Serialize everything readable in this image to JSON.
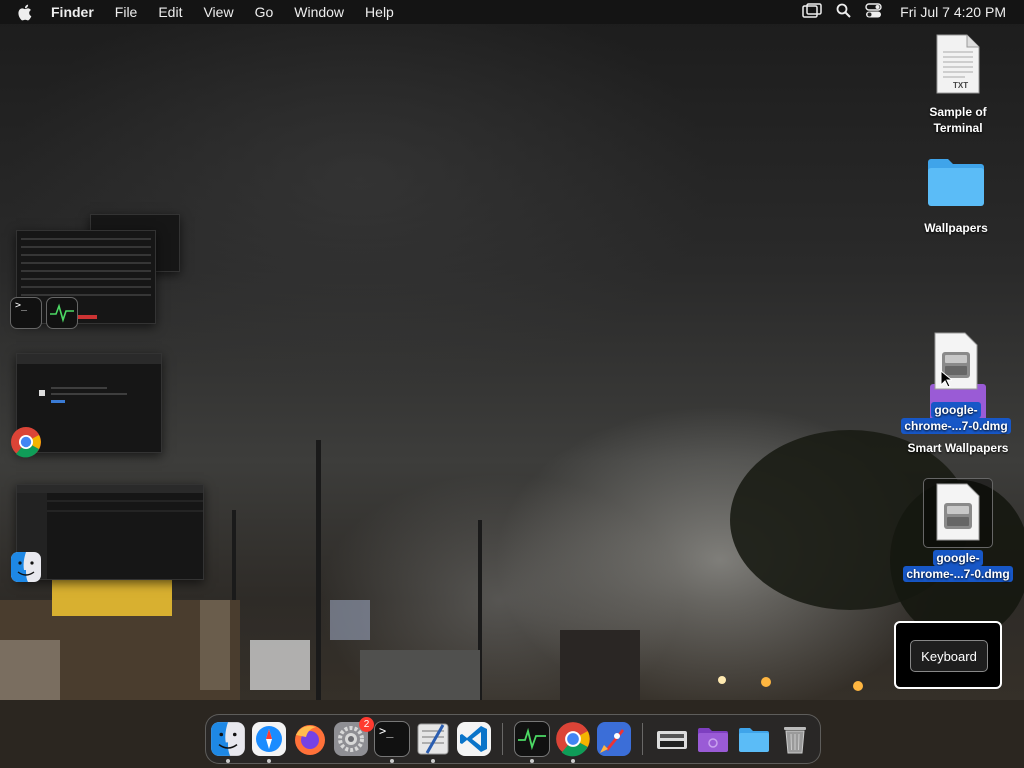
{
  "menubar": {
    "app_name": "Finder",
    "menus": [
      "File",
      "Edit",
      "View",
      "Go",
      "Window",
      "Help"
    ],
    "clock": "Fri Jul 7  4:20 PM",
    "status_icons": [
      "screen-mirroring-icon",
      "spotlight-search-icon",
      "control-center-icon"
    ]
  },
  "desktop": {
    "icons": [
      {
        "label_line1": "Sample of",
        "label_line2": "Terminal",
        "file_badge": "TXT",
        "type": "text-file"
      },
      {
        "label": "Wallpapers",
        "type": "folder"
      },
      {
        "label_line1": "google-",
        "label_line2": "chrome-...7-0.dmg",
        "type": "dmg",
        "selected": true
      },
      {
        "label": "Smart Wallpapers",
        "type": "folder"
      },
      {
        "label_line1": "google-",
        "label_line2": "chrome-...7-0.dmg",
        "type": "dmg",
        "selected": true
      }
    ]
  },
  "stage_manager": {
    "groups": [
      {
        "apps": [
          "terminal-icon",
          "activity-monitor-icon"
        ]
      },
      {
        "apps": [
          "chrome-icon"
        ]
      },
      {
        "apps": [
          "finder-icon"
        ]
      }
    ]
  },
  "dock": {
    "apps": [
      "finder-icon",
      "safari-icon",
      "firefox-icon",
      "system-settings-icon",
      "terminal-icon",
      "script-editor-icon",
      "vscode-icon",
      "activity-monitor-icon",
      "chrome-icon",
      "rocket-app-icon",
      "downloads-stack-icon",
      "folder-stack-icon",
      "folder-icon",
      "trash-icon"
    ],
    "settings_badge": "2"
  },
  "keyboard_hud": {
    "label": "Keyboard"
  },
  "colors": {
    "selection": "#1757c7",
    "folder": "#4fb3f6"
  }
}
